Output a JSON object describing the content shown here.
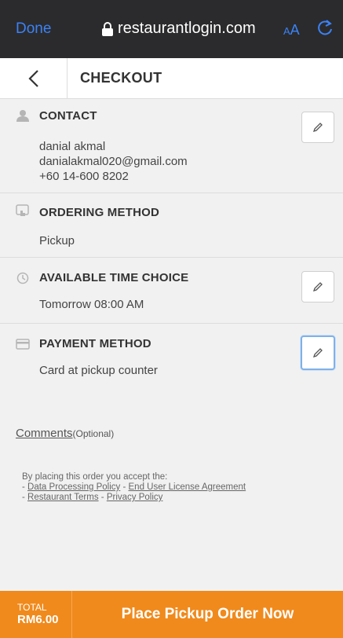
{
  "browser": {
    "done_label": "Done",
    "url": "restaurantlogin.com",
    "text_size_label_small": "A",
    "text_size_label_large": "A"
  },
  "header": {
    "title": "CHECKOUT"
  },
  "contact": {
    "title": "CONTACT",
    "name": "danial akmal",
    "email": "danialakmal020@gmail.com",
    "phone": "+60 14-600 8202"
  },
  "ordering_method": {
    "title": "ORDERING METHOD",
    "value": "Pickup"
  },
  "time_choice": {
    "title": "AVAILABLE TIME CHOICE",
    "value": "Tomorrow 08:00 AM"
  },
  "payment": {
    "title": "PAYMENT METHOD",
    "value": "Card at pickup counter"
  },
  "comments": {
    "link": "Comments",
    "optional": "(Optional)"
  },
  "terms": {
    "intro": "By placing this order you accept the:",
    "dash": "- ",
    "sep": " - ",
    "data_policy": "Data Processing Policy",
    "eula": "End User License Agreement",
    "restaurant_terms": "Restaurant Terms",
    "privacy_policy": "Privacy Policy"
  },
  "footer": {
    "total_label": "TOTAL",
    "total_amount": "RM6.00",
    "place_order_label": "Place Pickup Order Now"
  },
  "colors": {
    "accent": "#f08a1c",
    "browser_link": "#3b82f6",
    "browser_bar": "#2b2b2d"
  }
}
